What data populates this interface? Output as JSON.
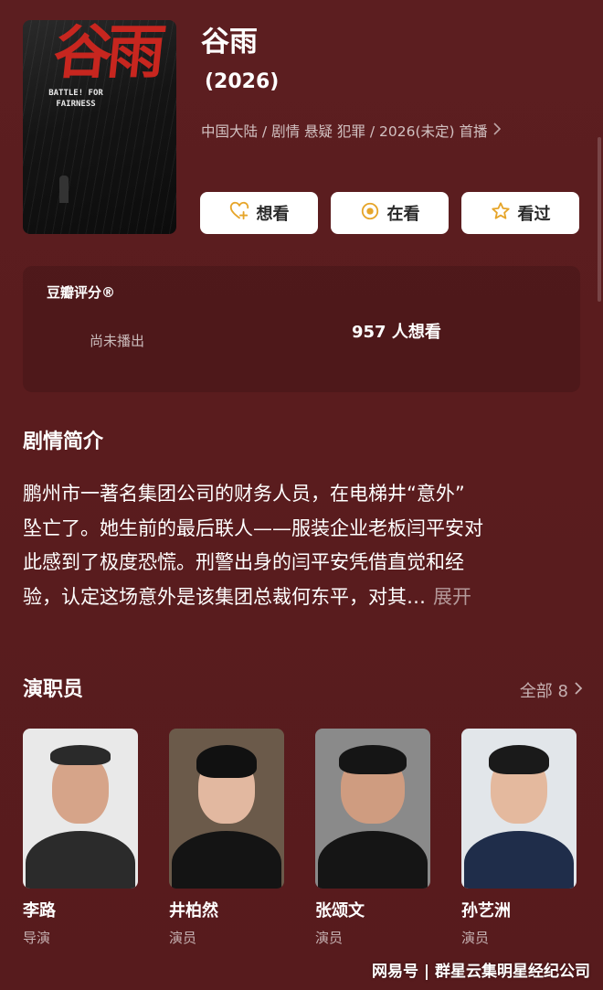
{
  "header": {
    "title": "谷雨",
    "year": "(2026)",
    "meta": "中国大陆 / 剧情 悬疑 犯罪 / 2026(未定) 首播",
    "poster_title": "谷雨",
    "poster_subtitle": "BATTLE! FOR FAIRNESS"
  },
  "actions": [
    {
      "label": "想看",
      "icon": "heart-plus-icon"
    },
    {
      "label": "在看",
      "icon": "target-icon"
    },
    {
      "label": "看过",
      "icon": "star-icon"
    }
  ],
  "rating": {
    "title": "豆瓣评分®",
    "status": "尚未播出",
    "want_count": "957 人想看"
  },
  "synopsis": {
    "title": "剧情简介",
    "lines": [
      "鹏州市一著名集团公司的财务人员，在电梯井“意外”",
      "坠亡了。她生前的最后联人——服装企业老板闫平安对",
      "此感到了极度恐慌。刑警出身的闫平安凭借直觉和经",
      "验，认定这场意外是该集团总裁何东平，对其…"
    ],
    "expand_label": "展开"
  },
  "cast": {
    "title": "演职员",
    "all_label": "全部 8",
    "members": [
      {
        "name": "李路",
        "role": "导演",
        "bg": "#e9e9e9"
      },
      {
        "name": "井柏然",
        "role": "演员",
        "bg": "#6b5a4a"
      },
      {
        "name": "张颂文",
        "role": "演员",
        "bg": "#8a8a8a"
      },
      {
        "name": "孙艺洲",
        "role": "演员",
        "bg": "#e2e6ea"
      }
    ]
  },
  "watermark": "网易号 | 群星云集明星经纪公司"
}
